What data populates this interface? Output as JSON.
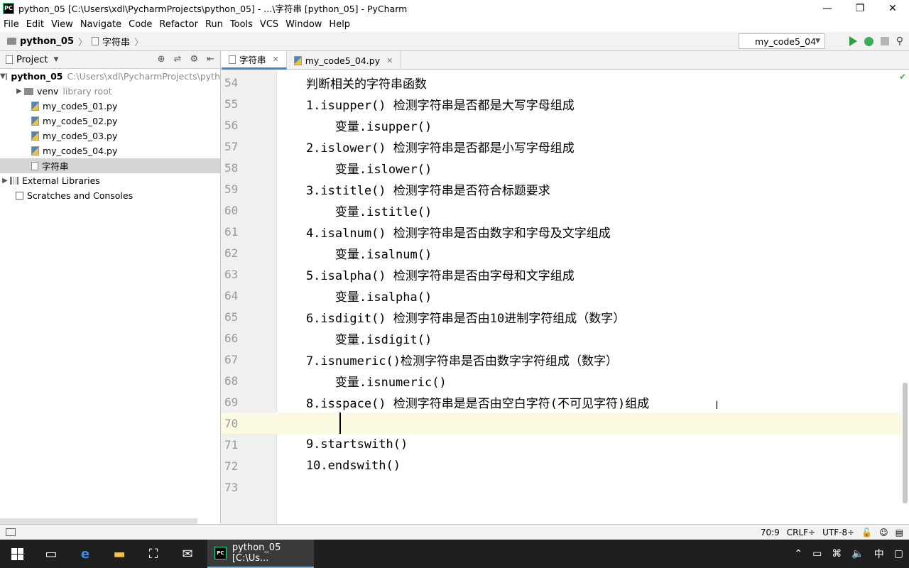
{
  "window": {
    "title": "python_05 [C:\\Users\\xdl\\PycharmProjects\\python_05] - ...\\字符串 [python_05] - PyCharm",
    "app_icon_text": "PC"
  },
  "menu": [
    "File",
    "Edit",
    "View",
    "Navigate",
    "Code",
    "Refactor",
    "Run",
    "Tools",
    "VCS",
    "Window",
    "Help"
  ],
  "breadcrumb": {
    "project": "python_05",
    "file": "字符串"
  },
  "run_config": {
    "name": "my_code5_04"
  },
  "project_panel": {
    "title": "Project",
    "root": {
      "name": "python_05",
      "path": "C:\\Users\\xdl\\PycharmProjects\\pyth"
    },
    "venv": {
      "name": "venv",
      "note": "library root"
    },
    "files": [
      "my_code5_01.py",
      "my_code5_02.py",
      "my_code5_03.py",
      "my_code5_04.py"
    ],
    "selected_file": "字符串",
    "external": "External Libraries",
    "scratches": "Scratches and Consoles"
  },
  "tabs": [
    {
      "label": "字符串"
    },
    {
      "label": "my_code5_04.py"
    }
  ],
  "editor": {
    "lines": [
      {
        "n": "54",
        "text": "    判断相关的字符串函数"
      },
      {
        "n": "55",
        "text": "    1.isupper() 检测字符串是否都是大写字母组成"
      },
      {
        "n": "56",
        "text": "        变量.isupper()"
      },
      {
        "n": "57",
        "text": "    2.islower() 检测字符串是否都是小写字母组成"
      },
      {
        "n": "58",
        "text": "        变量.islower()"
      },
      {
        "n": "59",
        "text": "    3.istitle() 检测字符串是否符合标题要求"
      },
      {
        "n": "60",
        "text": "        变量.istitle()"
      },
      {
        "n": "61",
        "text": "    4.isalnum() 检测字符串是否由数字和字母及文字组成"
      },
      {
        "n": "62",
        "text": "        变量.isalnum()"
      },
      {
        "n": "63",
        "text": "    5.isalpha() 检测字符串是否由字母和文字组成"
      },
      {
        "n": "64",
        "text": "        变量.isalpha()"
      },
      {
        "n": "65",
        "text": "    6.isdigit() 检测字符串是否由10进制字符组成（数字）"
      },
      {
        "n": "66",
        "text": "        变量.isdigit()"
      },
      {
        "n": "67",
        "text": "    7.isnumeric()检测字符串是否由数字字符组成（数字）"
      },
      {
        "n": "68",
        "text": "        变量.isnumeric()"
      },
      {
        "n": "69",
        "text": "    8.isspace() 检测字符串是是否由空白字符(不可见字符)组成"
      },
      {
        "n": "70",
        "text": ""
      },
      {
        "n": "71",
        "text": "    9.startswith()"
      },
      {
        "n": "72",
        "text": "    10.endswith()"
      },
      {
        "n": "73",
        "text": ""
      }
    ]
  },
  "status": {
    "position": "70:9",
    "line_sep": "CRLF÷",
    "encoding": "UTF-8÷"
  },
  "taskbar": {
    "app_label": "python_05 [C:\\Us...",
    "ime": "中"
  }
}
